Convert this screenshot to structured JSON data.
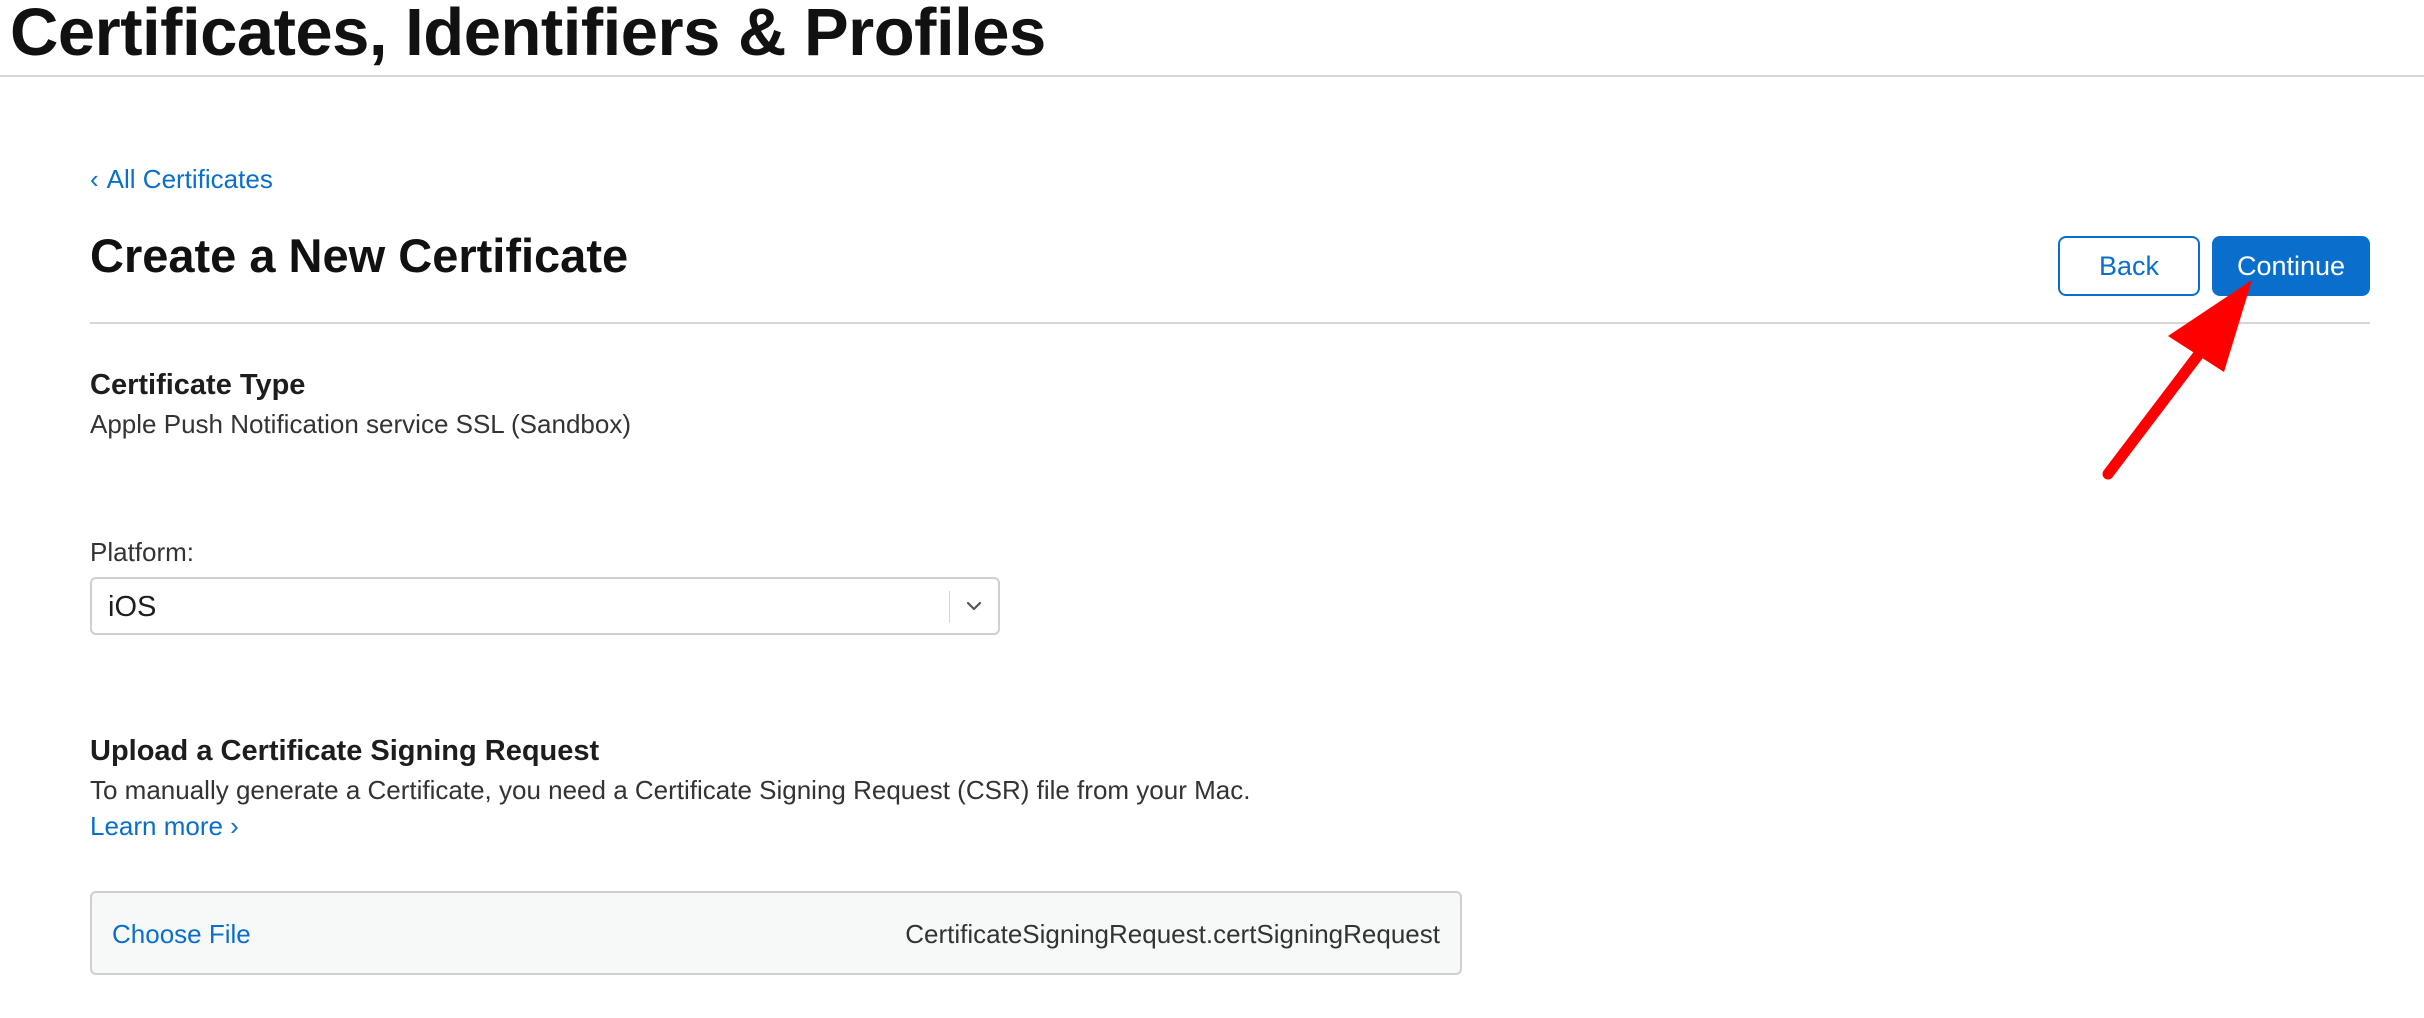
{
  "header": {
    "title": "Certificates, Identifiers & Profiles"
  },
  "nav": {
    "back_link_chevron": "‹",
    "back_link_label": "All Certificates"
  },
  "main": {
    "title": "Create a New Certificate",
    "buttons": {
      "back_label": "Back",
      "continue_label": "Continue"
    },
    "certificate_type": {
      "heading": "Certificate Type",
      "value": "Apple Push Notification service SSL (Sandbox)"
    },
    "platform": {
      "label": "Platform:",
      "selected": "iOS"
    },
    "upload": {
      "heading": "Upload a Certificate Signing Request",
      "description": "To manually generate a Certificate, you need a Certificate Signing Request (CSR) file from your Mac.",
      "learn_more_label": "Learn more ›",
      "choose_file_label": "Choose File",
      "file_name": "CertificateSigningRequest.certSigningRequest"
    }
  },
  "colors": {
    "accent": "#0a6fcc",
    "annotation_arrow": "#ff0000",
    "divider": "#d6d6d6",
    "text": "#1d1d1f"
  },
  "icons": {
    "back_link": "chevron-left-icon",
    "platform_select": "chevron-down-icon",
    "annotation": "red-arrow-icon"
  }
}
